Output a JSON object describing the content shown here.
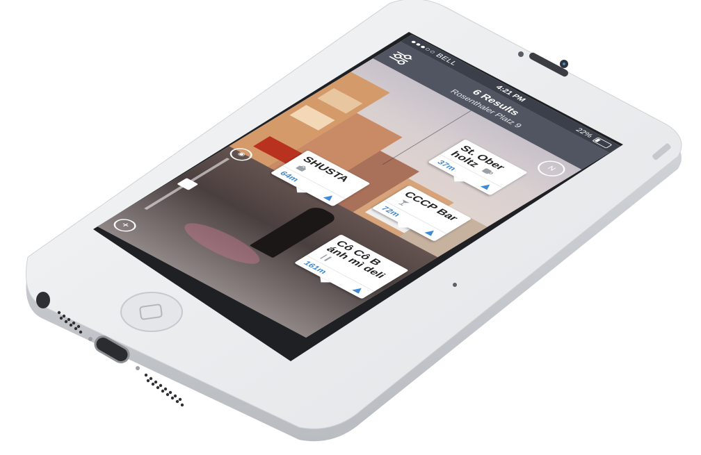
{
  "status_bar": {
    "carrier": "●●●○○ BELL",
    "time": "4:21 PM",
    "battery": "22%",
    "battery_level": 0.22
  },
  "nav": {
    "title": "6 Results",
    "subtitle": "Rosenthaler Platz 9"
  },
  "compass": {
    "label": "N",
    "icon": "compass-icon"
  },
  "filter": {
    "icon": "filter-sliders-icon"
  },
  "pois": [
    {
      "name": "St. Ober holtz",
      "distance": "37m",
      "category_icon": "coffee-cup-icon"
    },
    {
      "name": "CCCP Bar",
      "distance": "72m",
      "category_icon": "cocktail-glass-icon"
    },
    {
      "name": "SHUSTA",
      "distance": "64m",
      "category_icon": "shopping-bag-icon"
    },
    {
      "name": "Cô Cô B ánh mì deli",
      "distance": "161m",
      "category_icon": "fork-knife-icon"
    }
  ],
  "controls": {
    "locate_icon": "target-icon",
    "zoom_in_icon": "plus-icon",
    "zoom_in_label": "+",
    "slider_level": 0.5
  },
  "colors": {
    "accent": "#3d8ad6",
    "navbar": "#464c58",
    "phone_body": "#e9ebee"
  }
}
